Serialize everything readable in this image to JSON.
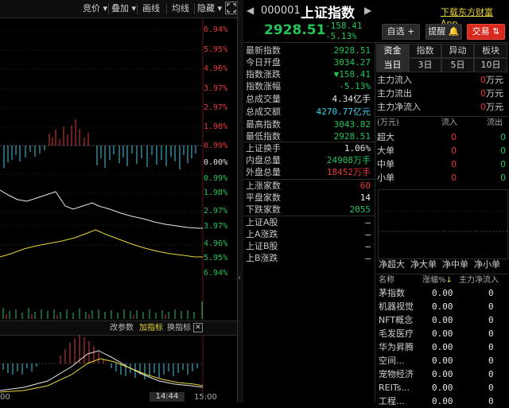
{
  "toolbar": {
    "items": [
      "竞价",
      "叠加",
      "画线",
      "均线",
      "隐藏"
    ],
    "bid_label": "竞价",
    "overlay_label": "叠加",
    "draw_label": "画线",
    "ma_label": "均线",
    "hide_label": "隐藏"
  },
  "chart": {
    "price_pct_labels": [
      "6.94%",
      "5.95%",
      "4.96%",
      "3.97%",
      "2.97%",
      "1.98%",
      "0.99%",
      "0.00%",
      "0.99%",
      "1.98%",
      "2.97%",
      "3.97%",
      "4.96%",
      "5.95%",
      "6.94%"
    ],
    "sub_toolbar": {
      "change_params": "改参数",
      "add_indicator": "加指标",
      "switch_indicator": "换指标"
    },
    "time_labels": [
      "00",
      "14:44",
      "15:00"
    ]
  },
  "header": {
    "code": "000001",
    "name": "上证指数",
    "download_link": "下载东方财富App",
    "price": "2928.51",
    "change": "-158.41",
    "change_pct": "-5.13%",
    "watchlist_label": "自选",
    "alert_label": "提醒",
    "trade_label": "交易"
  },
  "quote": {
    "group1": [
      {
        "label": "最新指数",
        "value": "2928.51",
        "color": "green"
      },
      {
        "label": "今日开盘",
        "value": "3034.27",
        "color": "green"
      },
      {
        "label": "指数涨跌",
        "value": "▼158.41",
        "color": "green"
      },
      {
        "label": "指数涨幅",
        "value": "-5.13%",
        "color": "green"
      },
      {
        "label": "总成交量",
        "value": "4.34亿手",
        "color": "white"
      },
      {
        "label": "总成交额",
        "value": "4270.77亿元",
        "color": "cyan"
      },
      {
        "label": "最高指数",
        "value": "3043.82",
        "color": "green"
      },
      {
        "label": "最低指数",
        "value": "2928.51",
        "color": "green"
      }
    ],
    "group2": [
      {
        "label": "上证换手",
        "value": "1.06%",
        "color": "white"
      },
      {
        "label": "内盘总量",
        "value": "24908万手",
        "color": "green"
      },
      {
        "label": "外盘总量",
        "value": "18452万手",
        "color": "red"
      }
    ],
    "group3": [
      {
        "label": "上涨家数",
        "value": "60",
        "color": "red"
      },
      {
        "label": "平盘家数",
        "value": "14",
        "color": "white"
      },
      {
        "label": "下跌家数",
        "value": "2055",
        "color": "green"
      }
    ],
    "group4": [
      {
        "label": "上证A股",
        "value": "—",
        "color": "white"
      },
      {
        "label": "上A涨跌",
        "value": "—",
        "color": "white"
      },
      {
        "label": "上证B股",
        "value": "—",
        "color": "white"
      },
      {
        "label": "上B涨跌",
        "value": "—",
        "color": "white"
      }
    ]
  },
  "fund": {
    "tabs_top": [
      "资金",
      "指数",
      "异动",
      "板块"
    ],
    "tabs_bottom": [
      "当日",
      "3日",
      "5日",
      "10日"
    ],
    "main_flow": [
      {
        "label": "主力流入",
        "value": "0",
        "unit": "万元"
      },
      {
        "label": "主力流出",
        "value": "0",
        "unit": "万元"
      },
      {
        "label": "主力净流入",
        "value": "0",
        "unit": "万元"
      }
    ],
    "table_headers": [
      "(万元)",
      "流入",
      "流出"
    ],
    "table_rows": [
      {
        "label": "超大",
        "in": "0",
        "out": "0"
      },
      {
        "label": "大单",
        "in": "0",
        "out": "0"
      },
      {
        "label": "中单",
        "in": "0",
        "out": "0"
      },
      {
        "label": "小单",
        "in": "0",
        "out": "0"
      }
    ],
    "bar_labels": [
      "净超大",
      "净大单",
      "净中单",
      "净小单"
    ],
    "list_headers": [
      "名称",
      "涨幅%",
      "主力净流入"
    ],
    "list_rows": [
      {
        "name": "茅指数",
        "pct": "0.00",
        "net": "0"
      },
      {
        "name": "机器视觉",
        "pct": "0.00",
        "net": "0"
      },
      {
        "name": "NFT概念",
        "pct": "0.00",
        "net": "0"
      },
      {
        "name": "毛发医疗",
        "pct": "0.00",
        "net": "0"
      },
      {
        "name": "华为昇腾",
        "pct": "0.00",
        "net": "0"
      },
      {
        "name": "空间...",
        "pct": "0.00",
        "net": "0"
      },
      {
        "name": "宠物经济",
        "pct": "0.00",
        "net": "0"
      },
      {
        "name": "REITs...",
        "pct": "0.00",
        "net": "0"
      },
      {
        "name": "工程...",
        "pct": "0.00",
        "net": "0"
      }
    ]
  },
  "colors": {
    "up": "#e83a3a",
    "down": "#23c45a",
    "accent": "#e8d63a",
    "trade_btn": "#d9281e"
  }
}
